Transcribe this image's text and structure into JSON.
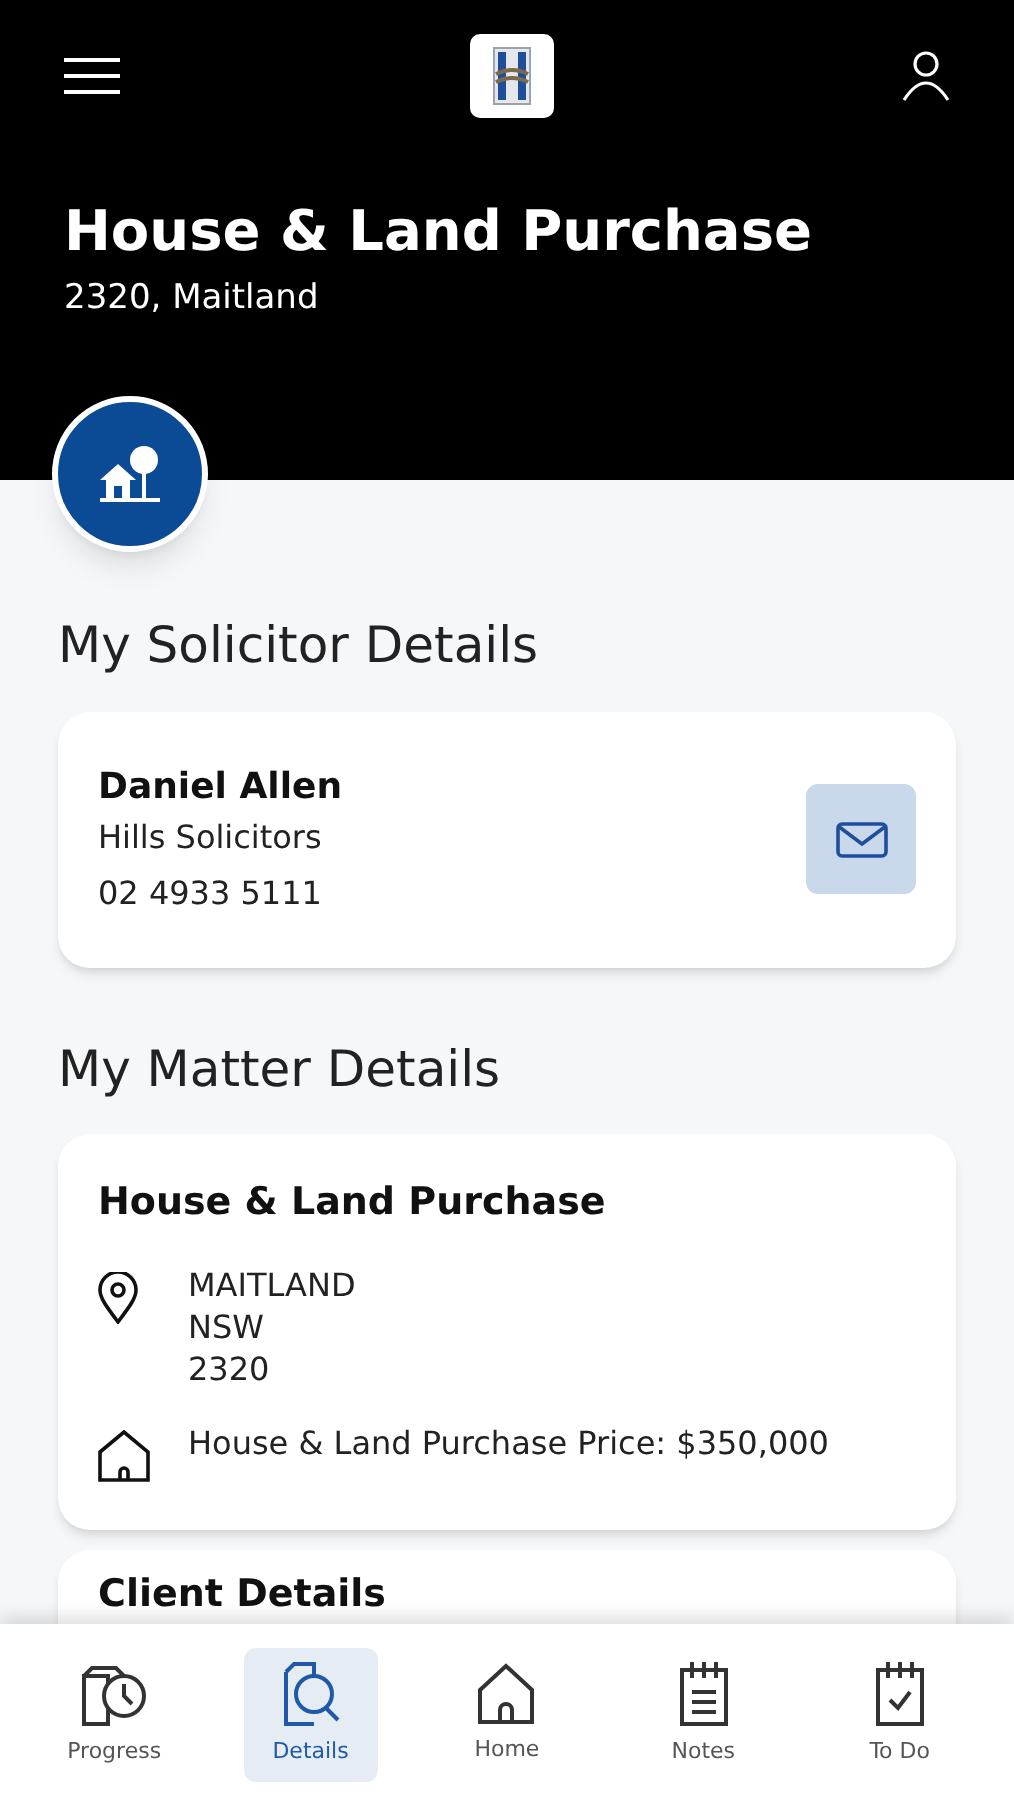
{
  "header": {
    "title": "House & Land Purchase",
    "subtitle": "2320, Maitland"
  },
  "solicitor_section": {
    "heading": "My Solicitor Details",
    "name": "Daniel Allen",
    "firm": "Hills Solicitors",
    "phone": "02 4933 5111"
  },
  "matter_section": {
    "heading": "My Matter Details",
    "card_title": "House & Land Purchase",
    "rows": [
      {
        "kind": "location",
        "lines": [
          "MAITLAND",
          "NSW",
          "2320"
        ]
      },
      {
        "kind": "price",
        "lines": [
          "House & Land Purchase Price: $350,000"
        ]
      }
    ]
  },
  "next_card": {
    "title": "Client Details"
  },
  "nav": [
    {
      "kind": "progress",
      "label": "Progress",
      "selected": false
    },
    {
      "kind": "details",
      "label": "Details",
      "selected": true
    },
    {
      "kind": "home",
      "label": "Home",
      "selected": false
    },
    {
      "kind": "notes",
      "label": "Notes",
      "selected": false
    },
    {
      "kind": "todo",
      "label": "To Do",
      "selected": false
    }
  ]
}
